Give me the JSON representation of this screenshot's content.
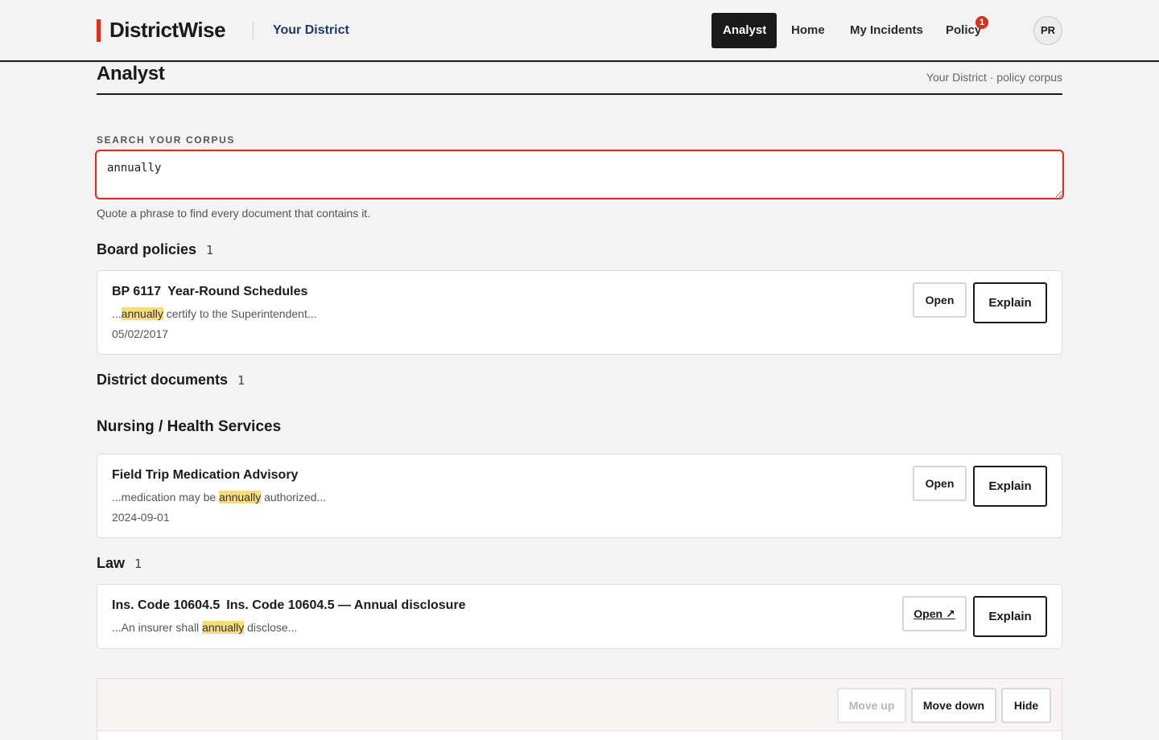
{
  "header": {
    "brand": "DistrictWise",
    "district_link": "Your District",
    "nav": [
      {
        "label": "Analyst",
        "active": true
      },
      {
        "label": "Home",
        "active": false
      },
      {
        "label": "My Incidents",
        "active": false
      },
      {
        "label": "Policy",
        "active": false
      }
    ],
    "policy_badge": "1",
    "avatar_initials": "PR"
  },
  "page": {
    "title": "Analyst",
    "breadcrumb": "Your District · policy corpus"
  },
  "search": {
    "label": "SEARCH YOUR CORPUS",
    "value": "annually",
    "hint": "Quote a phrase to find every document that contains it."
  },
  "sections": {
    "board": {
      "heading": "Board policies",
      "count": "1",
      "result": {
        "code": "BP 6117",
        "title": "Year-Round Schedules",
        "snippet_pre": "...",
        "snippet_hl": "annually",
        "snippet_post": " certify to the Superintendent...",
        "date": "05/02/2017",
        "open_label": "Open",
        "explain_label": "Explain"
      }
    },
    "district": {
      "heading": "District documents",
      "count": "1"
    },
    "nursing": {
      "heading": "Nursing / Health Services",
      "result": {
        "title": "Field Trip Medication Advisory",
        "snippet_pre": "...medication may be ",
        "snippet_hl": "annually",
        "snippet_post": " authorized...",
        "date": "2024-09-01",
        "open_label": "Open",
        "explain_label": "Explain"
      }
    },
    "law": {
      "heading": "Law",
      "count": "1",
      "result": {
        "code": "Ins. Code 10604.5",
        "title": "Ins. Code 10604.5 — Annual disclosure",
        "snippet_pre": "...An insurer shall ",
        "snippet_hl": "annually",
        "snippet_post": " disclose...",
        "open_label": "Open ↗",
        "explain_label": "Explain"
      }
    }
  },
  "panel": {
    "move_up": "Move up",
    "move_down": "Move down",
    "hide": "Hide"
  },
  "colors": {
    "accent": "#d8321f",
    "highlight": "#f9dd7a",
    "ink": "#1a1a1a"
  }
}
